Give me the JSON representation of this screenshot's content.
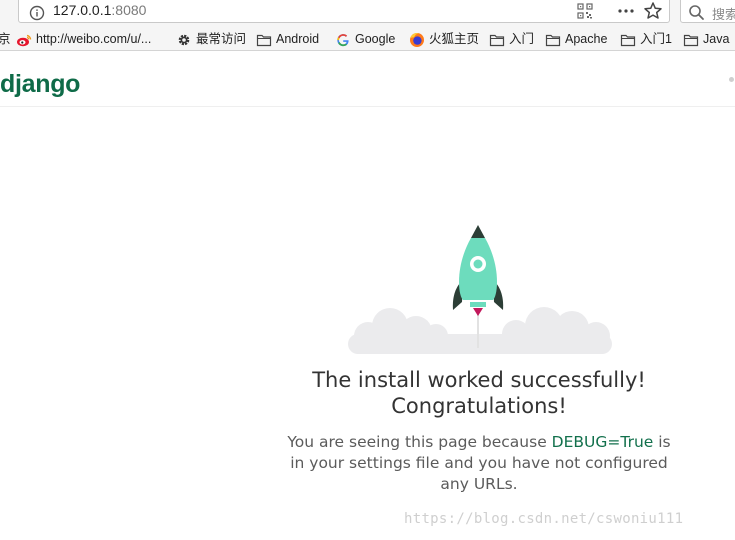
{
  "browser": {
    "url_host": "127.0.0.1",
    "url_port": ":8080",
    "search_placeholder": "搜索"
  },
  "bookmarks": [
    {
      "label": "http://weibo.com/u/...",
      "icon": "weibo-icon"
    },
    {
      "label": "最常访问",
      "icon": "gear-icon"
    },
    {
      "label": "Android",
      "icon": "folder-icon"
    },
    {
      "label": "Google",
      "icon": "google-icon"
    },
    {
      "label": "火狐主页",
      "icon": "firefox-icon"
    },
    {
      "label": "入门",
      "icon": "folder-icon"
    },
    {
      "label": "Apache",
      "icon": "folder-icon"
    },
    {
      "label": "入门1",
      "icon": "folder-icon"
    },
    {
      "label": "Java",
      "icon": "folder-icon"
    }
  ],
  "bookmark_partial": "京",
  "page": {
    "logo": "django",
    "title_line1": "The install worked successfully!",
    "title_line2": "Congratulations!",
    "body_pre": "You are seeing this page because ",
    "body_debug": "DEBUG=True",
    "body_post": " is in your settings file and you have not configured any URLs."
  },
  "watermark": "https://blog.csdn.net/cswoniu111",
  "colors": {
    "django_green": "#0f6b48",
    "rocket_teal": "#6ddcbd",
    "rocket_dark": "#2c3e36",
    "cloud": "#ebebeb"
  }
}
